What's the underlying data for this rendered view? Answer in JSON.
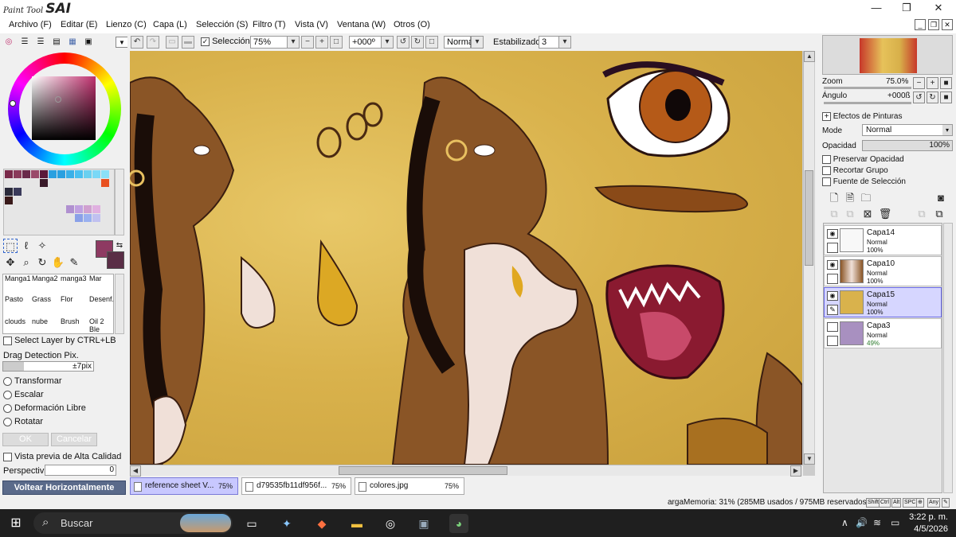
{
  "app": {
    "logo_small": "Paint Tool",
    "logo_big": "SAI",
    "window_controls": {
      "minimize": "—",
      "maximize": "❐",
      "close": "✕"
    }
  },
  "menu": {
    "items": [
      "Archivo (F)",
      "Editar (E)",
      "Lienzo (C)",
      "Capa (L)",
      "Selección (S)",
      "Filtro (T)",
      "Vista (V)",
      "Ventana (W)",
      "Otros (O)"
    ],
    "mdi": {
      "minimize": "_",
      "restore": "❐",
      "close": "✕"
    }
  },
  "toolbar": {
    "selection_label": "Selección",
    "zoom_value": "75%",
    "angle_value": "+000º",
    "blend_value": "Normal",
    "stabilizer_label": "Estabilizador",
    "stabilizer_value": "3"
  },
  "left": {
    "brushes": [
      [
        "Manga1",
        "Manga2",
        "manga3",
        "Mar"
      ],
      [
        "Pasto",
        "Grass",
        "Flor",
        "Desenf."
      ],
      [
        "clouds",
        "nube",
        "Brush",
        "Oil 2 Ble"
      ]
    ],
    "select_layer_label": "Select Layer by CTRL+LB",
    "drag_label": "Drag Detection Pix.",
    "drag_value": "±7pix",
    "transform_options": [
      "Transformar",
      "Escalar",
      "Deformación Libre",
      "Rotatar"
    ],
    "ok_label": "OK",
    "cancel_label": "Cancelar",
    "preview_label": "Vista previa de Alta Calidad",
    "perspective_label": "Perspectiva",
    "perspective_value": "0",
    "flip_label": "Voltear Horizontalmente",
    "fg_color": "#8e3a62",
    "bg_color": "#5a2e46"
  },
  "navigator": {
    "zoom_label": "Zoom",
    "zoom_value": "75.0%",
    "angle_label": "Ángulo",
    "angle_value": "+000ß"
  },
  "layers_panel": {
    "effects_label": "Efectos de Pinturas",
    "mode_label": "Mode",
    "mode_value": "Normal",
    "opacity_label": "Opacidad",
    "opacity_value": "100%",
    "options": [
      "Preservar Opacidad",
      "Recortar Grupo",
      "Fuente de Selección"
    ],
    "layers": [
      {
        "name": "Capa14",
        "mode": "Normal",
        "opacity": "100%"
      },
      {
        "name": "Capa10",
        "mode": "Normal",
        "opacity": "100%"
      },
      {
        "name": "Capa15",
        "mode": "Normal",
        "opacity": "100%"
      },
      {
        "name": "Capa3",
        "mode": "Normal",
        "opacity": "49%"
      }
    ]
  },
  "doc_tabs": [
    {
      "name": "reference sheet V...",
      "zoom": "75%"
    },
    {
      "name": "d79535fb11df956f...",
      "zoom": "75%"
    },
    {
      "name": "colores.jpg",
      "zoom": "75%"
    }
  ],
  "status": {
    "memory": "argaMemoria: 31% (285MB usados / 975MB reservados)",
    "keys": [
      "Shift",
      "Ctrl",
      "Alt",
      "SPC",
      "⊕",
      "Any",
      "✎"
    ]
  },
  "taskbar": {
    "search_label": "Buscar",
    "time": "3:22 p. m.",
    "date": "4/5/2026"
  }
}
